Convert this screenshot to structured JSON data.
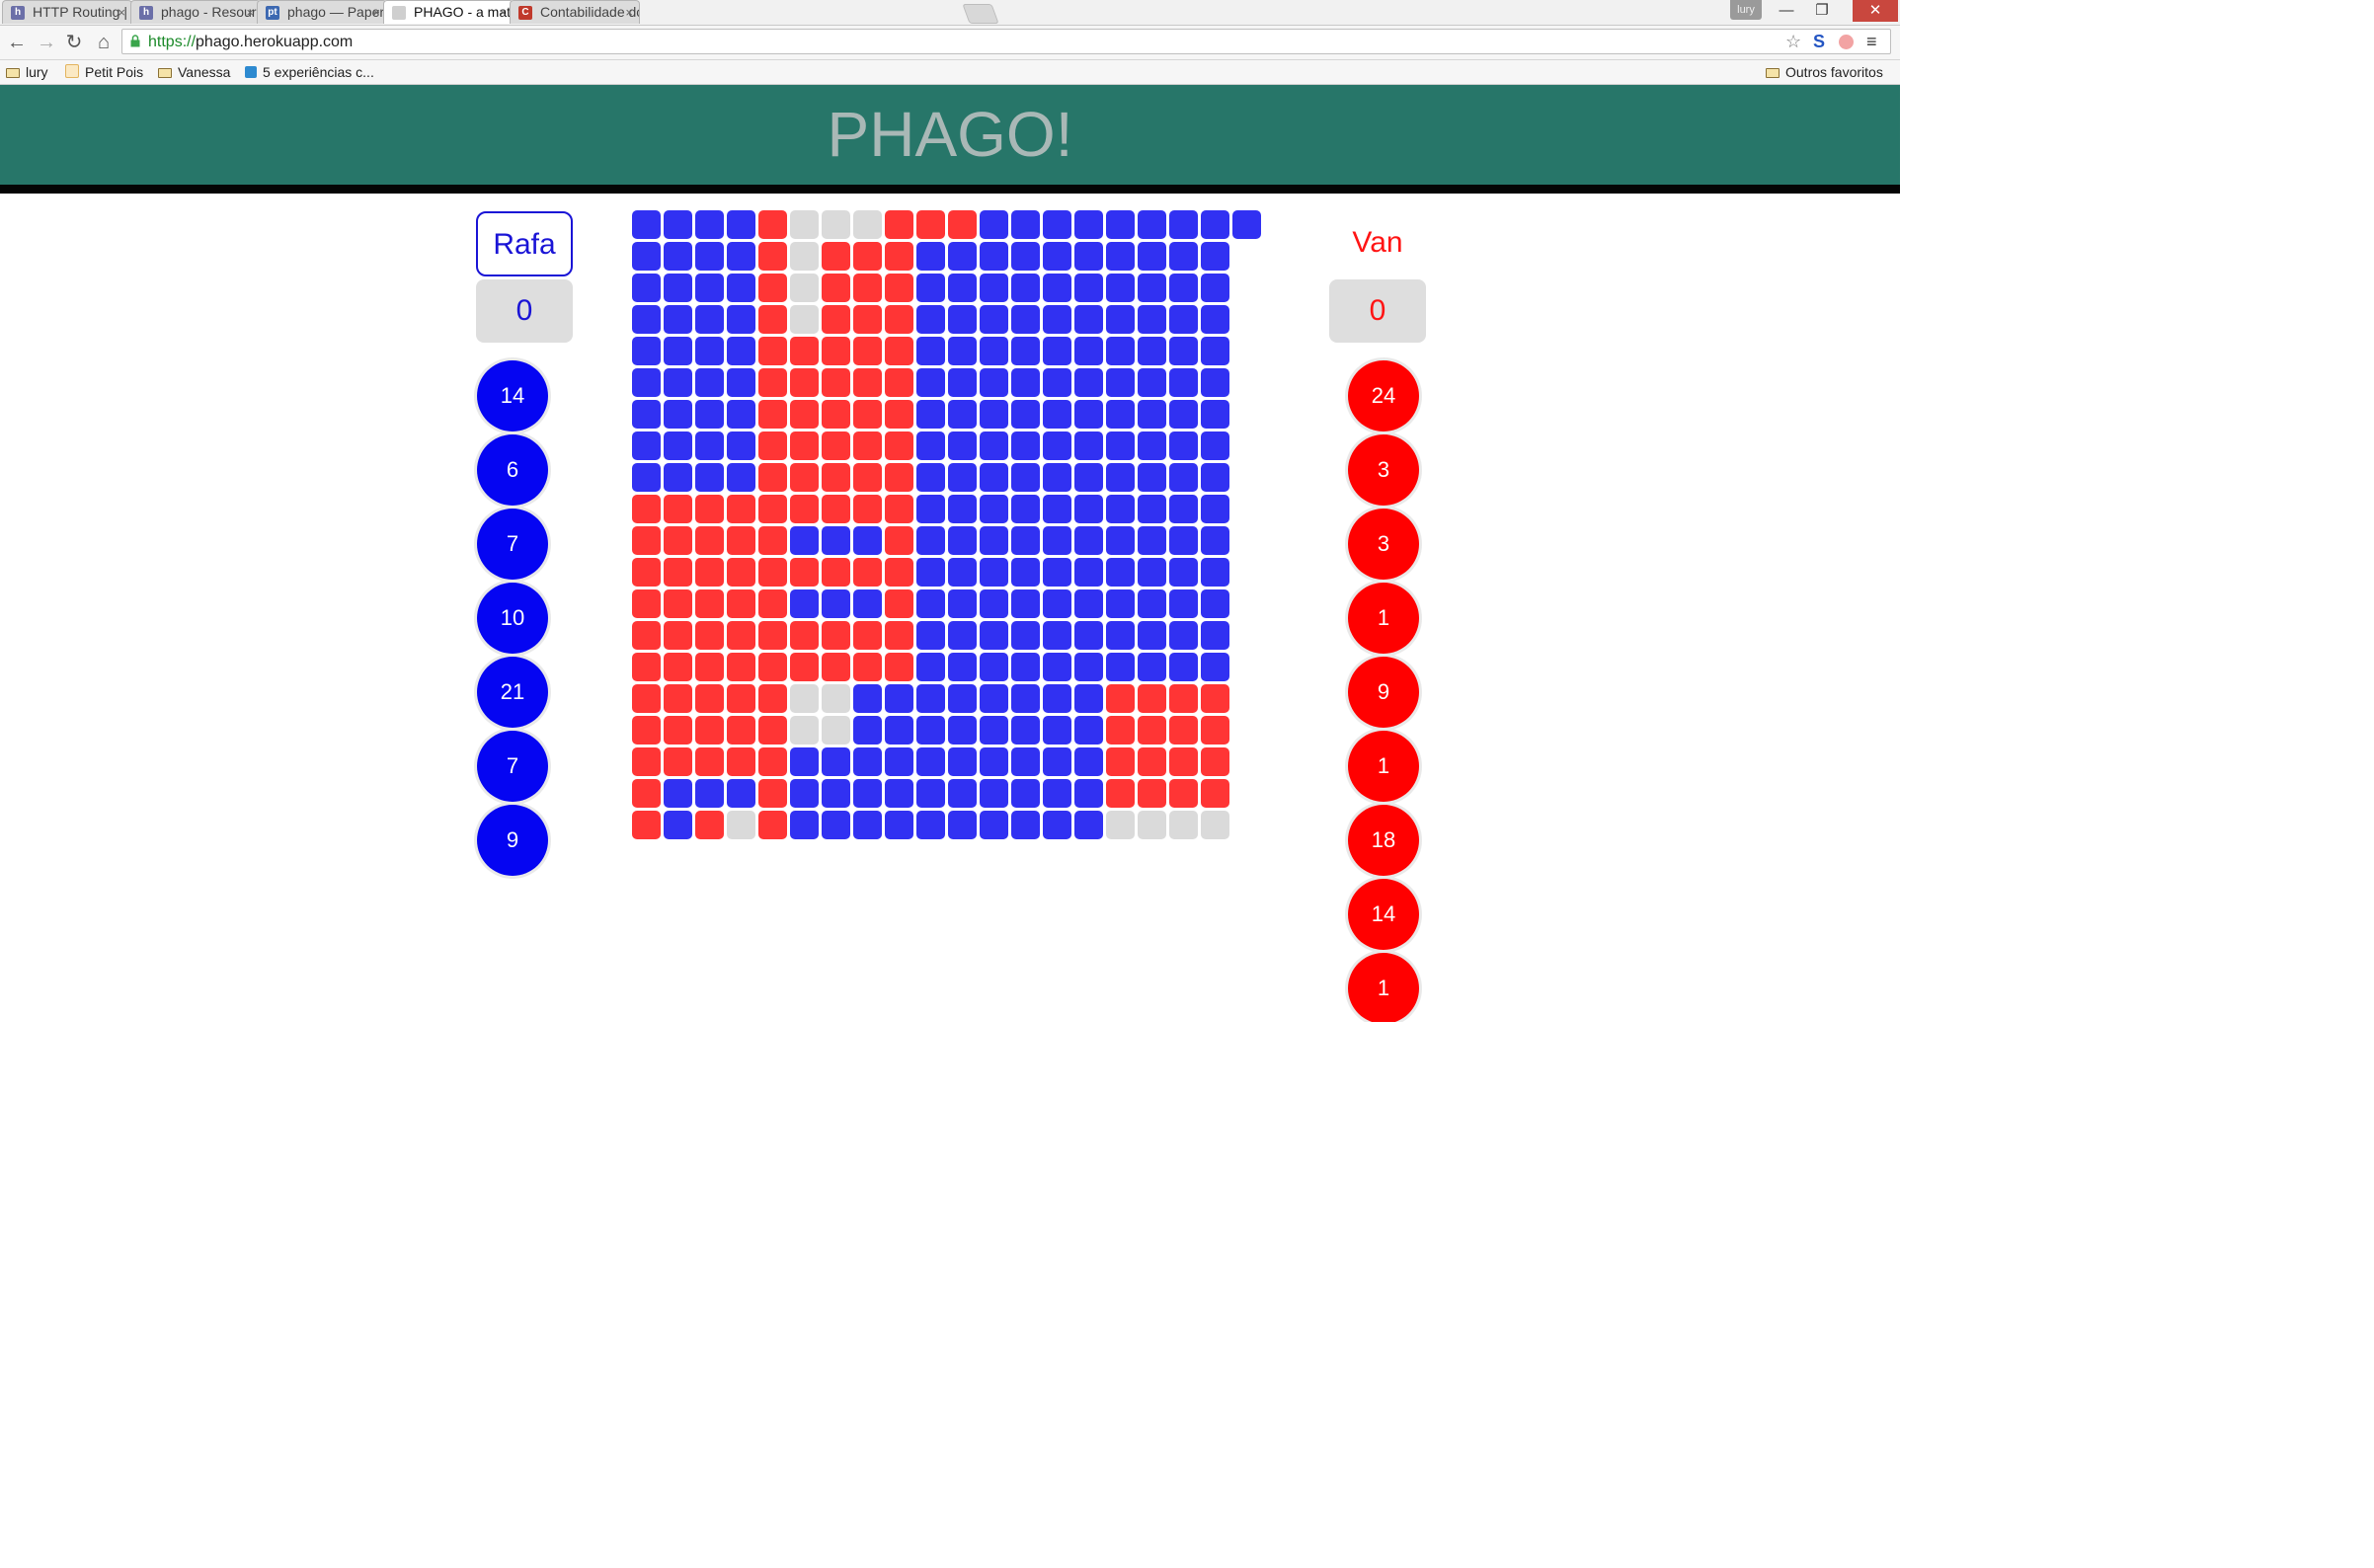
{
  "browser": {
    "tabs": [
      {
        "title": "HTTP Routing | Hero",
        "favicon_color": "#6b6fa8",
        "favicon_glyph": "h",
        "active": false
      },
      {
        "title": "phago - Resources | ",
        "favicon_color": "#6b6fa8",
        "favicon_glyph": "h",
        "active": false
      },
      {
        "title": "phago — Papertrail",
        "favicon_color": "#3c68b1",
        "favicon_glyph": "pt",
        "active": false
      },
      {
        "title": "PHAGO - a math gar",
        "favicon_color": "#cfcfcf",
        "favicon_glyph": "",
        "active": true
      },
      {
        "title": "Contabilidade do Pla",
        "favicon_color": "#c0392b",
        "favicon_glyph": "C",
        "active": false
      }
    ],
    "close_glyph": "×",
    "user_badge": "lury",
    "window_buttons": {
      "minimize": "—",
      "maximize": "❐",
      "close": "✕"
    },
    "toolbar": {
      "back": "←",
      "forward": "→",
      "reload": "↻",
      "home": "⌂"
    },
    "url_scheme": "https://",
    "url_rest": "phago.herokuapp.com",
    "omnibox_icons": {
      "star": "☆",
      "s_ext": "S",
      "menu": "≡"
    },
    "bookmarks": [
      {
        "label": "lury",
        "icon": "folder-icon"
      },
      {
        "label": "Petit Pois",
        "icon": "page-icon"
      },
      {
        "label": "Vanessa",
        "icon": "folder-icon"
      },
      {
        "label": "5 experiências c...",
        "icon": "bookmark-icon"
      }
    ],
    "other_bookmarks": "Outros favoritos"
  },
  "app": {
    "title": "PHAGO!",
    "player1": {
      "name": "Rafa",
      "score": "0",
      "chips": [
        "14",
        "6",
        "7",
        "10",
        "21",
        "7",
        "9"
      ]
    },
    "player2": {
      "name": "Van",
      "score": "0",
      "chips": [
        "24",
        "3",
        "3",
        "1",
        "9",
        "1",
        "18",
        "14",
        "1"
      ]
    },
    "colors": {
      "blue": "#3131f2",
      "red": "#ff3535",
      "empty": "#dadada",
      "header": "#277669"
    },
    "board": [
      "BBBBREEERRRBBBBBBBBBB",
      "BBBBRERRRBBBBBBBBBB",
      "BBBBRERRRBBBBBBBBBB",
      "BBBBRERRRBBBBBBBBBB",
      "BBBBRRRRRBBBBBBBBBB",
      "BBBBRRRRRBBBBBBBBBB",
      "BBBBRRRRRBBBBBBBBBB",
      "BBBBRRRRRBBBBBBBBBB",
      "BBBBRRRRRBBBBBBBBBB",
      "RRRRRRRRRBBBBBBBBBB",
      "RRRRRBBBRBBBBBBBBBB",
      "RRRRRRRRRBBBBBBBBBB",
      "RRRRRBBBRBBBBBBBBBB",
      "RRRRRRRRRBBBBBBBBBB",
      "RRRRRRRRRBBBBBBBBBB",
      "RRRRREEBBBBBBBBRRRR",
      "RRRRREEBBBBBBBBRRRR",
      "RRRRRBBBBBBBBBBRRRR",
      "RBBBRBBBBBBBBBBRRRR",
      "RBRERBBBBBBBBBBEEEE"
    ]
  }
}
